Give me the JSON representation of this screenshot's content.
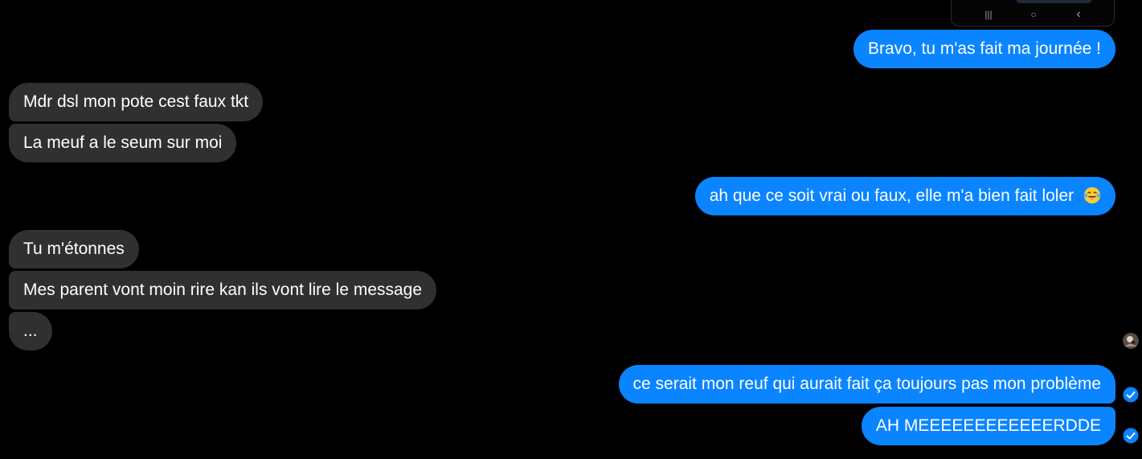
{
  "conversation": {
    "messages": [
      {
        "side": "out",
        "text": "Bravo, tu m'as fait ma journée !"
      },
      {
        "side": "in",
        "text": "Mdr dsl mon pote cest faux tkt"
      },
      {
        "side": "in",
        "text": "La meuf a le seum sur moi"
      },
      {
        "side": "out",
        "text": "ah que ce soit vrai ou faux, elle m'a bien fait loler",
        "emoji": "tears-of-joy-emoji"
      },
      {
        "side": "in",
        "text": "Tu m'étonnes"
      },
      {
        "side": "in",
        "text": "Mes parent vont moin rire kan ils vont lire le message"
      },
      {
        "side": "in",
        "text": "..."
      },
      {
        "side": "out",
        "text": "ce serait mon reuf qui aurait fait ça toujours pas mon problème"
      },
      {
        "side": "out",
        "text": "AH MEEEEEEEEEEEERDDE"
      }
    ]
  },
  "embedded_screenshot": {
    "nav_recent": "|||",
    "nav_home": "○",
    "nav_back": "‹"
  },
  "colors": {
    "background": "#000000",
    "incoming_bubble": "#303030",
    "outgoing_bubble": "#0a84ff",
    "text": "#ffffff",
    "read_receipt": "#0a84ff"
  }
}
